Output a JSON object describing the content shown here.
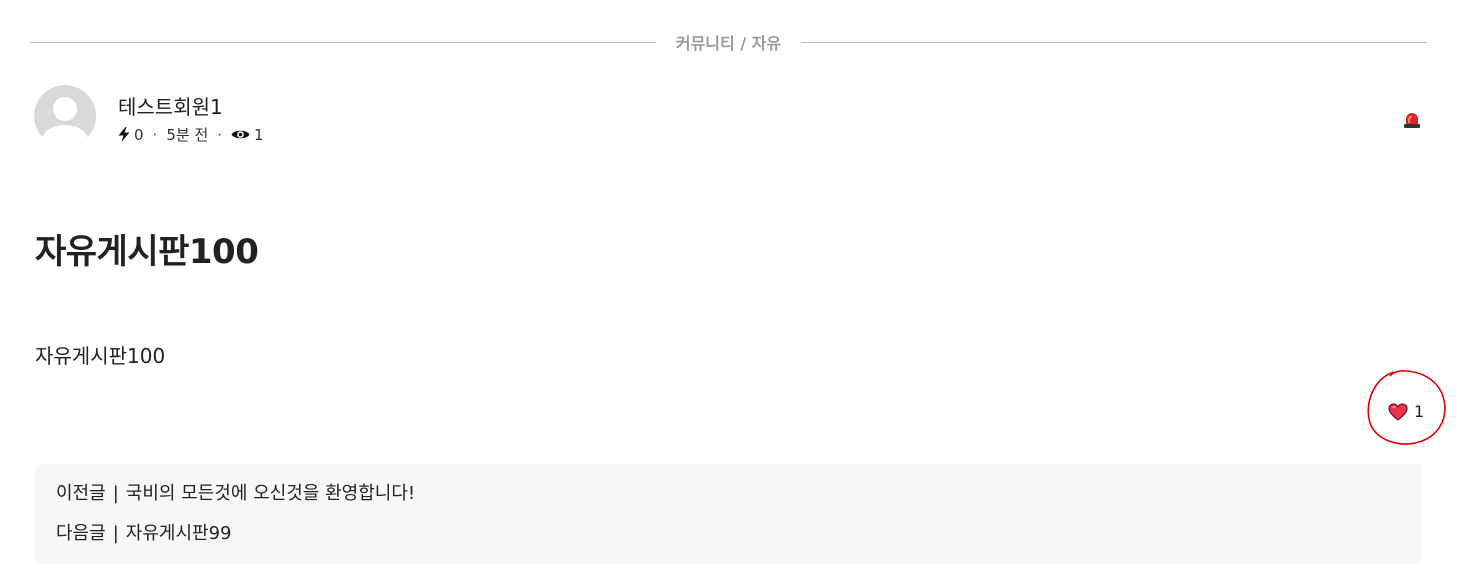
{
  "breadcrumb": {
    "text": "커뮤니티 / 자유"
  },
  "author": {
    "name": "테스트회원1",
    "points": "0",
    "time_ago": "5분 전",
    "views": "1"
  },
  "post": {
    "title": "자유게시판100",
    "body": "자유게시판100",
    "like_count": "1"
  },
  "navigation": {
    "prev_label": "이전글",
    "prev_title": "국비의 모든것에 오신것을 환영합니다!",
    "next_label": "다음글",
    "next_title": "자유게시판99",
    "separator": "|"
  },
  "icons": {
    "points": "lightning-icon",
    "views": "eye-icon",
    "report": "siren-icon",
    "like": "heart-icon"
  },
  "colors": {
    "heart": "#e8334a",
    "siren": "#e02424",
    "annotation": "#e00000"
  }
}
